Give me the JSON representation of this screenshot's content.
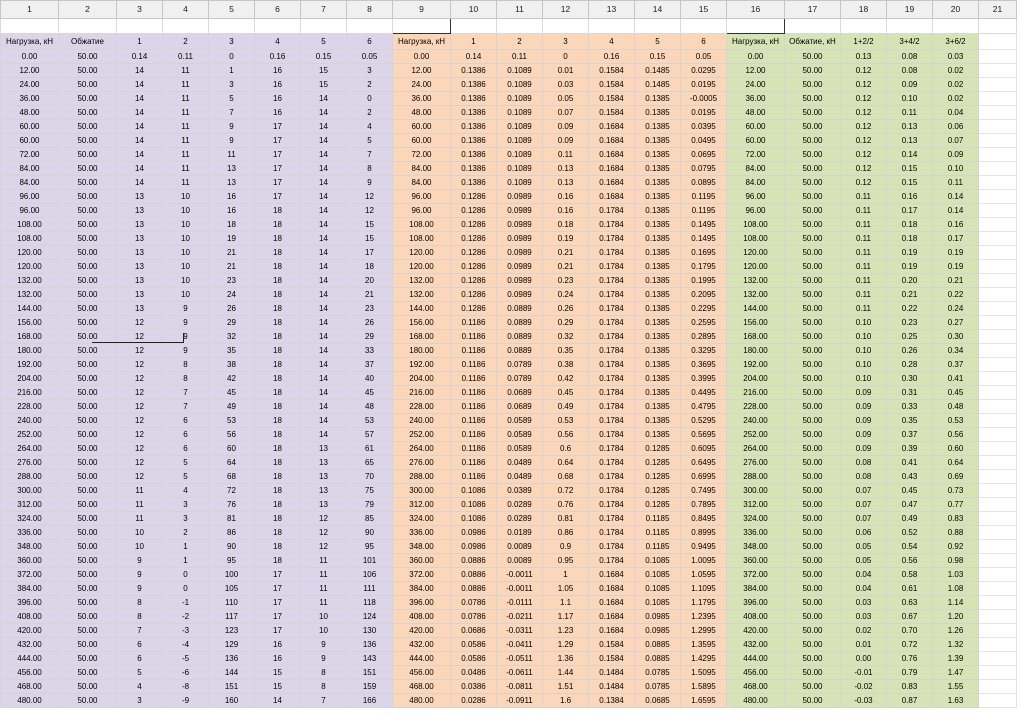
{
  "column_headers": [
    "1",
    "2",
    "3",
    "4",
    "5",
    "6",
    "7",
    "8",
    "9",
    "10",
    "11",
    "12",
    "13",
    "14",
    "15",
    "16",
    "17",
    "18",
    "19",
    "20",
    "21"
  ],
  "header_row": [
    "Нагрузка, кН",
    "Обжатие",
    "1",
    "2",
    "3",
    "4",
    "5",
    "6",
    "Нагрузка, кН",
    "1",
    "2",
    "3",
    "4",
    "5",
    "6",
    "Нагрузка, кН",
    "Обжатие, кН",
    "1+2/2",
    "3+4/2",
    "3+6/2",
    ""
  ],
  "rows": [
    [
      "0.00",
      "50.00",
      "0.14",
      "0.11",
      "0",
      "0.16",
      "0.15",
      "0.05",
      "0.00",
      "0.14",
      "0.11",
      "0",
      "0.16",
      "0.15",
      "0.05",
      "0.00",
      "50.00",
      "0.13",
      "0.08",
      "0.03",
      ""
    ],
    [
      "12.00",
      "50.00",
      "14",
      "11",
      "1",
      "16",
      "15",
      "3",
      "12.00",
      "0.1386",
      "0.1089",
      "0.01",
      "0.1584",
      "0.1485",
      "0.0295",
      "12.00",
      "50.00",
      "0.12",
      "0.08",
      "0.02",
      ""
    ],
    [
      "24.00",
      "50.00",
      "14",
      "11",
      "3",
      "16",
      "15",
      "2",
      "24.00",
      "0.1386",
      "0.1089",
      "0.03",
      "0.1584",
      "0.1485",
      "0.0195",
      "24.00",
      "50.00",
      "0.12",
      "0.09",
      "0.02",
      ""
    ],
    [
      "36.00",
      "50.00",
      "14",
      "11",
      "5",
      "16",
      "14",
      "0",
      "36.00",
      "0.1386",
      "0.1089",
      "0.05",
      "0.1584",
      "0.1385",
      "-0.0005",
      "36.00",
      "50.00",
      "0.12",
      "0.10",
      "0.02",
      ""
    ],
    [
      "48.00",
      "50.00",
      "14",
      "11",
      "7",
      "16",
      "14",
      "2",
      "48.00",
      "0.1386",
      "0.1089",
      "0.07",
      "0.1584",
      "0.1385",
      "0.0195",
      "48.00",
      "50.00",
      "0.12",
      "0.11",
      "0.04",
      ""
    ],
    [
      "60.00",
      "50.00",
      "14",
      "11",
      "9",
      "17",
      "14",
      "4",
      "60.00",
      "0.1386",
      "0.1089",
      "0.09",
      "0.1684",
      "0.1385",
      "0.0395",
      "60.00",
      "50.00",
      "0.12",
      "0.13",
      "0.06",
      ""
    ],
    [
      "60.00",
      "50.00",
      "14",
      "11",
      "9",
      "17",
      "14",
      "5",
      "60.00",
      "0.1386",
      "0.1089",
      "0.09",
      "0.1684",
      "0.1385",
      "0.0495",
      "60.00",
      "50.00",
      "0.12",
      "0.13",
      "0.07",
      ""
    ],
    [
      "72.00",
      "50.00",
      "14",
      "11",
      "11",
      "17",
      "14",
      "7",
      "72.00",
      "0.1386",
      "0.1089",
      "0.11",
      "0.1684",
      "0.1385",
      "0.0695",
      "72.00",
      "50.00",
      "0.12",
      "0.14",
      "0.09",
      ""
    ],
    [
      "84.00",
      "50.00",
      "14",
      "11",
      "13",
      "17",
      "14",
      "8",
      "84.00",
      "0.1386",
      "0.1089",
      "0.13",
      "0.1684",
      "0.1385",
      "0.0795",
      "84.00",
      "50.00",
      "0.12",
      "0.15",
      "0.10",
      ""
    ],
    [
      "84.00",
      "50.00",
      "14",
      "11",
      "13",
      "17",
      "14",
      "9",
      "84.00",
      "0.1386",
      "0.1089",
      "0.13",
      "0.1684",
      "0.1385",
      "0.0895",
      "84.00",
      "50.00",
      "0.12",
      "0.15",
      "0.11",
      ""
    ],
    [
      "96.00",
      "50.00",
      "13",
      "10",
      "16",
      "17",
      "14",
      "12",
      "96.00",
      "0.1286",
      "0.0989",
      "0.16",
      "0.1684",
      "0.1385",
      "0.1195",
      "96.00",
      "50.00",
      "0.11",
      "0.16",
      "0.14",
      ""
    ],
    [
      "96.00",
      "50.00",
      "13",
      "10",
      "16",
      "18",
      "14",
      "12",
      "96.00",
      "0.1286",
      "0.0989",
      "0.16",
      "0.1784",
      "0.1385",
      "0.1195",
      "96.00",
      "50.00",
      "0.11",
      "0.17",
      "0.14",
      ""
    ],
    [
      "108.00",
      "50.00",
      "13",
      "10",
      "18",
      "18",
      "14",
      "15",
      "108.00",
      "0.1286",
      "0.0989",
      "0.18",
      "0.1784",
      "0.1385",
      "0.1495",
      "108.00",
      "50.00",
      "0.11",
      "0.18",
      "0.16",
      ""
    ],
    [
      "108.00",
      "50.00",
      "13",
      "10",
      "19",
      "18",
      "14",
      "15",
      "108.00",
      "0.1286",
      "0.0989",
      "0.19",
      "0.1784",
      "0.1385",
      "0.1495",
      "108.00",
      "50.00",
      "0.11",
      "0.18",
      "0.17",
      ""
    ],
    [
      "120.00",
      "50.00",
      "13",
      "10",
      "21",
      "18",
      "14",
      "17",
      "120.00",
      "0.1286",
      "0.0989",
      "0.21",
      "0.1784",
      "0.1385",
      "0.1695",
      "120.00",
      "50.00",
      "0.11",
      "0.19",
      "0.19",
      ""
    ],
    [
      "120.00",
      "50.00",
      "13",
      "10",
      "21",
      "18",
      "14",
      "18",
      "120.00",
      "0.1286",
      "0.0989",
      "0.21",
      "0.1784",
      "0.1385",
      "0.1795",
      "120.00",
      "50.00",
      "0.11",
      "0.19",
      "0.19",
      ""
    ],
    [
      "132.00",
      "50.00",
      "13",
      "10",
      "23",
      "18",
      "14",
      "20",
      "132.00",
      "0.1286",
      "0.0989",
      "0.23",
      "0.1784",
      "0.1385",
      "0.1995",
      "132.00",
      "50.00",
      "0.11",
      "0.20",
      "0.21",
      ""
    ],
    [
      "132.00",
      "50.00",
      "13",
      "10",
      "24",
      "18",
      "14",
      "21",
      "132.00",
      "0.1286",
      "0.0989",
      "0.24",
      "0.1784",
      "0.1385",
      "0.2095",
      "132.00",
      "50.00",
      "0.11",
      "0.21",
      "0.22",
      ""
    ],
    [
      "144.00",
      "50.00",
      "13",
      "9",
      "26",
      "18",
      "14",
      "23",
      "144.00",
      "0.1286",
      "0.0889",
      "0.26",
      "0.1784",
      "0.1385",
      "0.2295",
      "144.00",
      "50.00",
      "0.11",
      "0.22",
      "0.24",
      ""
    ],
    [
      "156.00",
      "50.00",
      "12",
      "9",
      "29",
      "18",
      "14",
      "26",
      "156.00",
      "0.1186",
      "0.0889",
      "0.29",
      "0.1784",
      "0.1385",
      "0.2595",
      "156.00",
      "50.00",
      "0.10",
      "0.23",
      "0.27",
      ""
    ],
    [
      "168.00",
      "50.00",
      "12",
      "9",
      "32",
      "18",
      "14",
      "29",
      "168.00",
      "0.1186",
      "0.0889",
      "0.32",
      "0.1784",
      "0.1385",
      "0.2895",
      "168.00",
      "50.00",
      "0.10",
      "0.25",
      "0.30",
      ""
    ],
    [
      "180.00",
      "50.00",
      "12",
      "9",
      "35",
      "18",
      "14",
      "33",
      "180.00",
      "0.1186",
      "0.0889",
      "0.35",
      "0.1784",
      "0.1385",
      "0.3295",
      "180.00",
      "50.00",
      "0.10",
      "0.26",
      "0.34",
      ""
    ],
    [
      "192.00",
      "50.00",
      "12",
      "8",
      "38",
      "18",
      "14",
      "37",
      "192.00",
      "0.1186",
      "0.0789",
      "0.38",
      "0.1784",
      "0.1385",
      "0.3695",
      "192.00",
      "50.00",
      "0.10",
      "0.28",
      "0.37",
      ""
    ],
    [
      "204.00",
      "50.00",
      "12",
      "8",
      "42",
      "18",
      "14",
      "40",
      "204.00",
      "0.1186",
      "0.0789",
      "0.42",
      "0.1784",
      "0.1385",
      "0.3995",
      "204.00",
      "50.00",
      "0.10",
      "0.30",
      "0.41",
      ""
    ],
    [
      "216.00",
      "50.00",
      "12",
      "7",
      "45",
      "18",
      "14",
      "45",
      "216.00",
      "0.1186",
      "0.0689",
      "0.45",
      "0.1784",
      "0.1385",
      "0.4495",
      "216.00",
      "50.00",
      "0.09",
      "0.31",
      "0.45",
      ""
    ],
    [
      "228.00",
      "50.00",
      "12",
      "7",
      "49",
      "18",
      "14",
      "48",
      "228.00",
      "0.1186",
      "0.0689",
      "0.49",
      "0.1784",
      "0.1385",
      "0.4795",
      "228.00",
      "50.00",
      "0.09",
      "0.33",
      "0.48",
      ""
    ],
    [
      "240.00",
      "50.00",
      "12",
      "6",
      "53",
      "18",
      "14",
      "53",
      "240.00",
      "0.1186",
      "0.0589",
      "0.53",
      "0.1784",
      "0.1385",
      "0.5295",
      "240.00",
      "50.00",
      "0.09",
      "0.35",
      "0.53",
      ""
    ],
    [
      "252.00",
      "50.00",
      "12",
      "6",
      "56",
      "18",
      "14",
      "57",
      "252.00",
      "0.1186",
      "0.0589",
      "0.56",
      "0.1784",
      "0.1385",
      "0.5695",
      "252.00",
      "50.00",
      "0.09",
      "0.37",
      "0.56",
      ""
    ],
    [
      "264.00",
      "50.00",
      "12",
      "6",
      "60",
      "18",
      "13",
      "61",
      "264.00",
      "0.1186",
      "0.0589",
      "0.6",
      "0.1784",
      "0.1285",
      "0.6095",
      "264.00",
      "50.00",
      "0.09",
      "0.39",
      "0.60",
      ""
    ],
    [
      "276.00",
      "50.00",
      "12",
      "5",
      "64",
      "18",
      "13",
      "65",
      "276.00",
      "0.1186",
      "0.0489",
      "0.64",
      "0.1784",
      "0.1285",
      "0.6495",
      "276.00",
      "50.00",
      "0.08",
      "0.41",
      "0.64",
      ""
    ],
    [
      "288.00",
      "50.00",
      "12",
      "5",
      "68",
      "18",
      "13",
      "70",
      "288.00",
      "0.1186",
      "0.0489",
      "0.68",
      "0.1784",
      "0.1285",
      "0.6995",
      "288.00",
      "50.00",
      "0.08",
      "0.43",
      "0.69",
      ""
    ],
    [
      "300.00",
      "50.00",
      "11",
      "4",
      "72",
      "18",
      "13",
      "75",
      "300.00",
      "0.1086",
      "0.0389",
      "0.72",
      "0.1784",
      "0.1285",
      "0.7495",
      "300.00",
      "50.00",
      "0.07",
      "0.45",
      "0.73",
      ""
    ],
    [
      "312.00",
      "50.00",
      "11",
      "3",
      "76",
      "18",
      "13",
      "79",
      "312.00",
      "0.1086",
      "0.0289",
      "0.76",
      "0.1784",
      "0.1285",
      "0.7895",
      "312.00",
      "50.00",
      "0.07",
      "0.47",
      "0.77",
      ""
    ],
    [
      "324.00",
      "50.00",
      "11",
      "3",
      "81",
      "18",
      "12",
      "85",
      "324.00",
      "0.1086",
      "0.0289",
      "0.81",
      "0.1784",
      "0.1185",
      "0.8495",
      "324.00",
      "50.00",
      "0.07",
      "0.49",
      "0.83",
      ""
    ],
    [
      "336.00",
      "50.00",
      "10",
      "2",
      "86",
      "18",
      "12",
      "90",
      "336.00",
      "0.0986",
      "0.0189",
      "0.86",
      "0.1784",
      "0.1185",
      "0.8995",
      "336.00",
      "50.00",
      "0.06",
      "0.52",
      "0.88",
      ""
    ],
    [
      "348.00",
      "50.00",
      "10",
      "1",
      "90",
      "18",
      "12",
      "95",
      "348.00",
      "0.0986",
      "0.0089",
      "0.9",
      "0.1784",
      "0.1185",
      "0.9495",
      "348.00",
      "50.00",
      "0.05",
      "0.54",
      "0.92",
      ""
    ],
    [
      "360.00",
      "50.00",
      "9",
      "1",
      "95",
      "18",
      "11",
      "101",
      "360.00",
      "0.0886",
      "0.0089",
      "0.95",
      "0.1784",
      "0.1085",
      "1.0095",
      "360.00",
      "50.00",
      "0.05",
      "0.56",
      "0.98",
      ""
    ],
    [
      "372.00",
      "50.00",
      "9",
      "0",
      "100",
      "17",
      "11",
      "106",
      "372.00",
      "0.0886",
      "-0.0011",
      "1",
      "0.1684",
      "0.1085",
      "1.0595",
      "372.00",
      "50.00",
      "0.04",
      "0.58",
      "1.03",
      ""
    ],
    [
      "384.00",
      "50.00",
      "9",
      "0",
      "105",
      "17",
      "11",
      "111",
      "384.00",
      "0.0886",
      "-0.0011",
      "1.05",
      "0.1684",
      "0.1085",
      "1.1095",
      "384.00",
      "50.00",
      "0.04",
      "0.61",
      "1.08",
      ""
    ],
    [
      "396.00",
      "50.00",
      "8",
      "-1",
      "110",
      "17",
      "11",
      "118",
      "396.00",
      "0.0786",
      "-0.0111",
      "1.1",
      "0.1684",
      "0.1085",
      "1.1795",
      "396.00",
      "50.00",
      "0.03",
      "0.63",
      "1.14",
      ""
    ],
    [
      "408.00",
      "50.00",
      "8",
      "-2",
      "117",
      "17",
      "10",
      "124",
      "408.00",
      "0.0786",
      "-0.0211",
      "1.17",
      "0.1684",
      "0.0985",
      "1.2395",
      "408.00",
      "50.00",
      "0.03",
      "0.67",
      "1.20",
      ""
    ],
    [
      "420.00",
      "50.00",
      "7",
      "-3",
      "123",
      "17",
      "10",
      "130",
      "420.00",
      "0.0686",
      "-0.0311",
      "1.23",
      "0.1684",
      "0.0985",
      "1.2995",
      "420.00",
      "50.00",
      "0.02",
      "0.70",
      "1.26",
      ""
    ],
    [
      "432.00",
      "50.00",
      "6",
      "-4",
      "129",
      "16",
      "9",
      "136",
      "432.00",
      "0.0586",
      "-0.0411",
      "1.29",
      "0.1584",
      "0.0885",
      "1.3595",
      "432.00",
      "50.00",
      "0.01",
      "0.72",
      "1.32",
      ""
    ],
    [
      "444.00",
      "50.00",
      "6",
      "-5",
      "136",
      "16",
      "9",
      "143",
      "444.00",
      "0.0586",
      "-0.0511",
      "1.36",
      "0.1584",
      "0.0885",
      "1.4295",
      "444.00",
      "50.00",
      "0.00",
      "0.76",
      "1.39",
      ""
    ],
    [
      "456.00",
      "50.00",
      "5",
      "-6",
      "144",
      "15",
      "8",
      "151",
      "456.00",
      "0.0486",
      "-0.0611",
      "1.44",
      "0.1484",
      "0.0785",
      "1.5095",
      "456.00",
      "50.00",
      "-0.01",
      "0.79",
      "1.47",
      ""
    ],
    [
      "468.00",
      "50.00",
      "4",
      "-8",
      "151",
      "15",
      "8",
      "159",
      "468.00",
      "0.0386",
      "-0.0811",
      "1.51",
      "0.1484",
      "0.0785",
      "1.5895",
      "468.00",
      "50.00",
      "-0.02",
      "0.83",
      "1.55",
      ""
    ],
    [
      "480.00",
      "50.00",
      "3",
      "-9",
      "160",
      "14",
      "7",
      "166",
      "480.00",
      "0.0286",
      "-0.0911",
      "1.6",
      "0.1384",
      "0.0685",
      "1.6595",
      "480.00",
      "50.00",
      "-0.03",
      "0.87",
      "1.63",
      ""
    ]
  ],
  "colors": {
    "block1": "#dcd4e8",
    "block2": "#fbd6b9",
    "block3": "#d5e3b5",
    "header_bg": "#f0f0f0"
  }
}
